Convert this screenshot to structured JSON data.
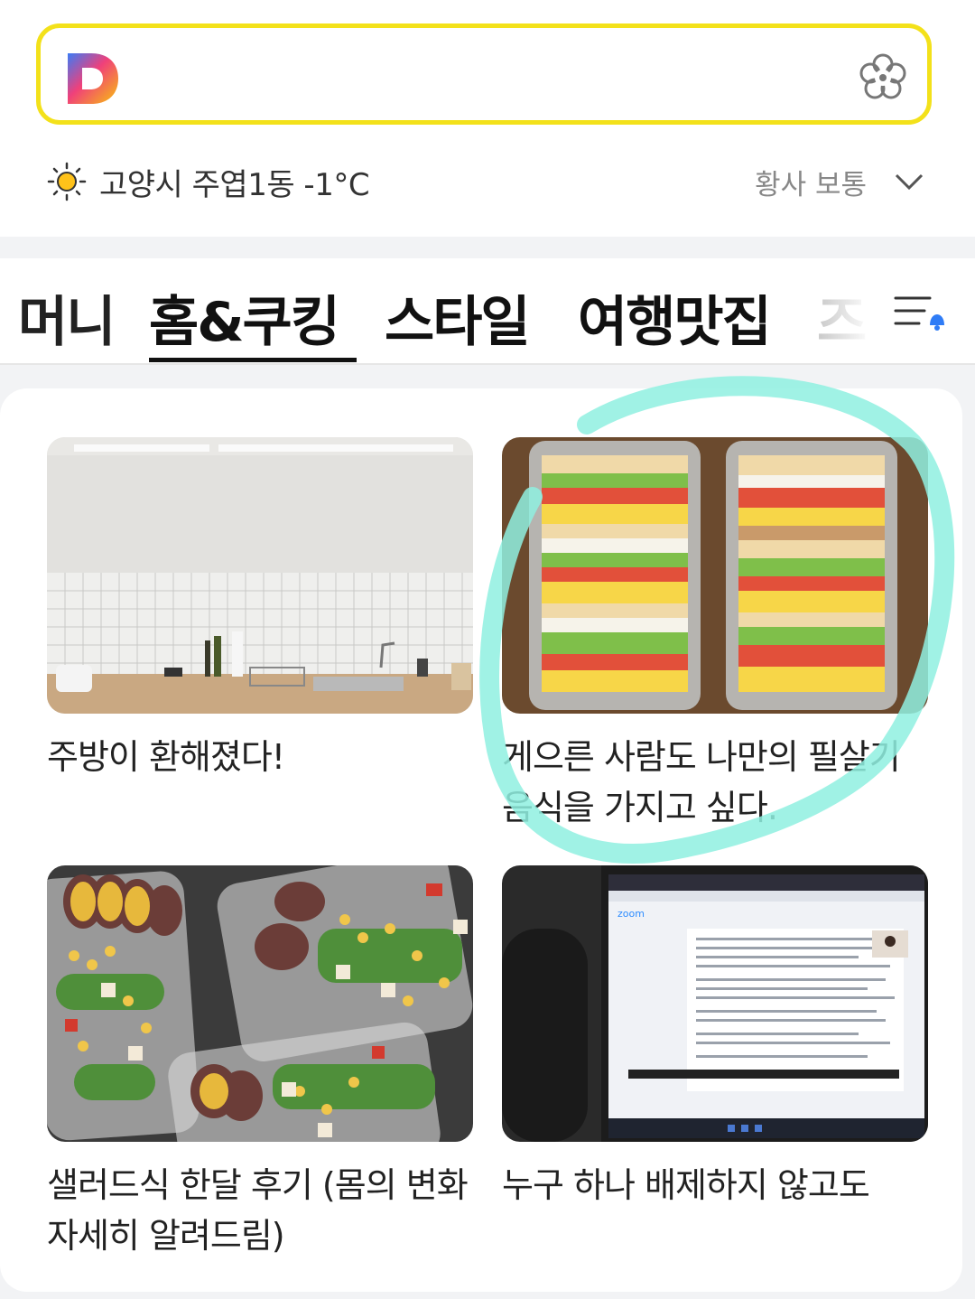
{
  "weather": {
    "location_temp": "고양시 주엽1동 -1°C",
    "dust": "황사 보통"
  },
  "tabs": [
    {
      "label": "머니"
    },
    {
      "label": "홈&쿠킹",
      "active": true
    },
    {
      "label": "스타일"
    },
    {
      "label": "여행맛집"
    },
    {
      "label": "즈"
    }
  ],
  "articles": [
    {
      "title": "주방이 환해졌다!"
    },
    {
      "title": "게으른 사람도 나만의 필살기 음식을 가지고 싶다."
    },
    {
      "title": "샐러드식 한달 후기 (몸의 변화 자세히 알려드림)"
    },
    {
      "title": "누구 하나 배제하지 않고도"
    }
  ],
  "thumb_texts": {
    "zoom": "zoom"
  },
  "colors": {
    "search_border": "#f3e11a",
    "annotation": "#8ff0e0",
    "alert_dot": "#2f7cf6"
  }
}
